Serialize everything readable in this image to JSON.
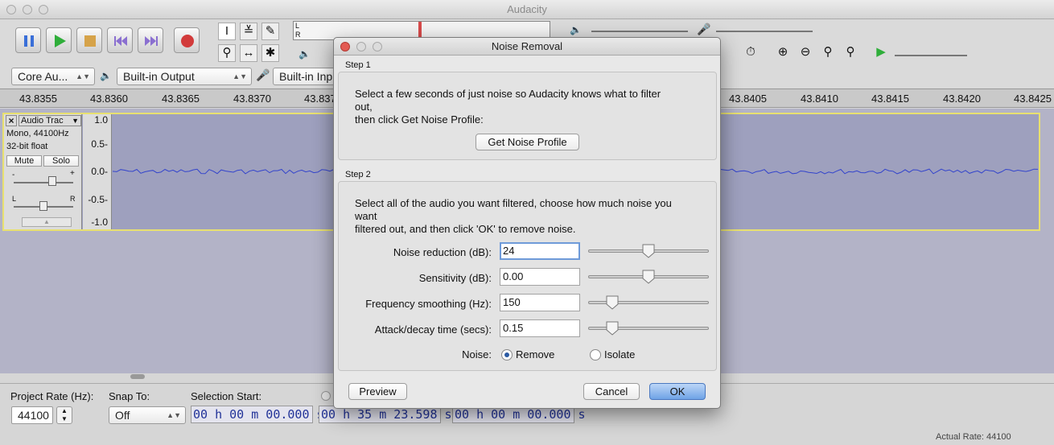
{
  "app": {
    "title": "Audacity"
  },
  "devices": {
    "host": "Core Au...",
    "output": "Built-in Output",
    "input": "Built-in Inp"
  },
  "meters": {
    "left": "L",
    "right": "R"
  },
  "ruler": {
    "ticks": [
      "43.8355",
      "43.8360",
      "43.8365",
      "43.8370",
      "43.837",
      "43.8405",
      "43.8410",
      "43.8415",
      "43.8420",
      "43.8425"
    ]
  },
  "track": {
    "name": "Audio Trac",
    "close": "×",
    "info_line1": "Mono, 44100Hz",
    "info_line2": "32-bit float",
    "mute_label": "Mute",
    "solo_label": "Solo",
    "gain_minus": "-",
    "gain_plus": "+",
    "pan_left": "L",
    "pan_right": "R",
    "scale": [
      "1.0",
      "0.5-",
      "0.0-",
      "-0.5-",
      "-1.0"
    ]
  },
  "bottom": {
    "project_rate_label": "Project Rate (Hz):",
    "project_rate_value": "44100",
    "snap_to_label": "Snap To:",
    "snap_to_value": "Off",
    "selection_start_label": "Selection Start:",
    "time1": "00 h 00 m 00.000 s",
    "time2": "00 h 35 m 23.598 s",
    "time3": "00 h 00 m 00.000 s",
    "actual_rate": "Actual Rate: 44100"
  },
  "dialog": {
    "title": "Noise Removal",
    "step1_label": "Step 1",
    "step1_text1": "Select a few seconds of just noise so Audacity knows what to filter",
    "step1_text2": "out,",
    "step1_text3": "then click Get Noise Profile:",
    "get_profile_button": "Get Noise Profile",
    "step2_label": "Step 2",
    "step2_text1": "Select all of the audio you want filtered, choose how much noise you",
    "step2_text2": "want",
    "step2_text3": "filtered out, and then click 'OK' to remove noise.",
    "fields": [
      {
        "label": "Noise reduction (dB):",
        "value": "24",
        "slider": 0.5
      },
      {
        "label": "Sensitivity (dB):",
        "value": "0.00",
        "slider": 0.5
      },
      {
        "label": "Frequency smoothing (Hz):",
        "value": "150",
        "slider": 0.2
      },
      {
        "label": "Attack/decay time (secs):",
        "value": "0.15",
        "slider": 0.2
      }
    ],
    "noise_label": "Noise:",
    "remove_label": "Remove",
    "isolate_label": "Isolate",
    "preview_button": "Preview",
    "cancel_button": "Cancel",
    "ok_button": "OK"
  },
  "colors": {
    "accent": "#2b5aa3",
    "waveform": "#3344cc",
    "selection_border": "#e8e070"
  }
}
